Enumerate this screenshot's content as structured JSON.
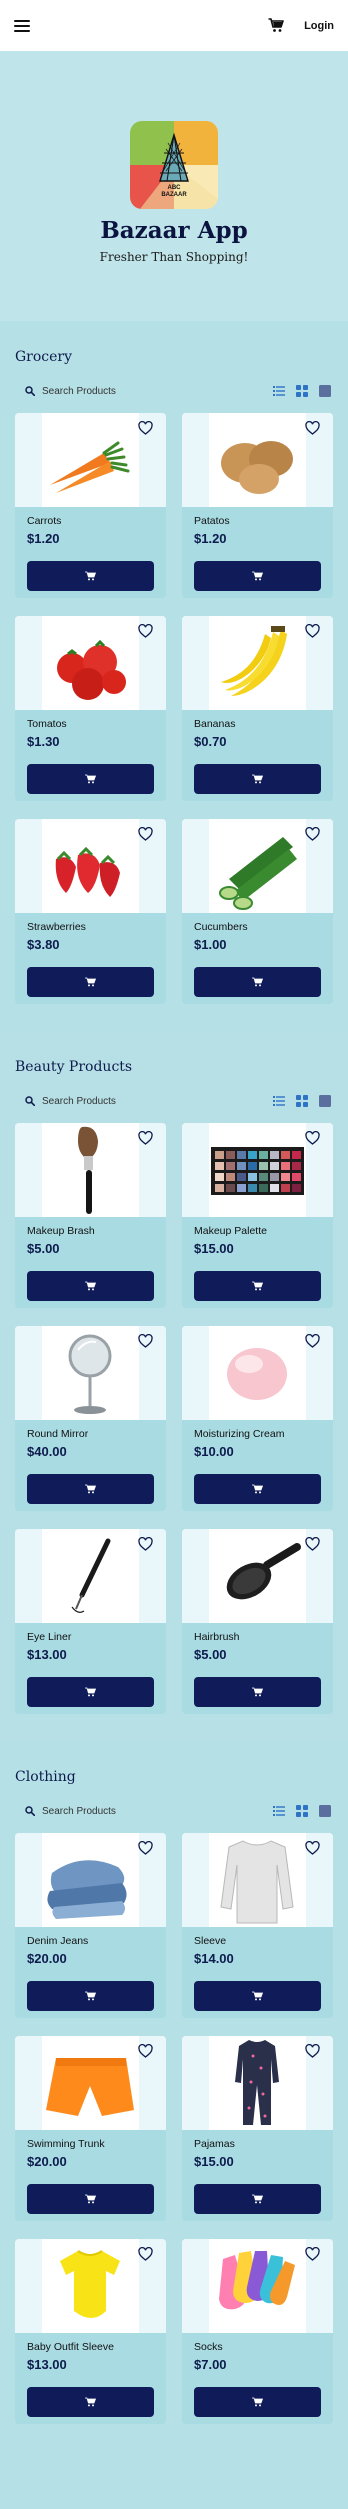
{
  "header": {
    "login_label": "Login",
    "menu_icon": "hamburger-menu-icon",
    "cart_icon": "shopping-cart-icon"
  },
  "hero": {
    "logo_text_line1": "ABC",
    "logo_text_line2": "BAZAAR",
    "title": "Bazaar App",
    "tagline": "Fresher Than Shopping!"
  },
  "colors": {
    "brand_navy": "#0f1c59",
    "page_bg": "#b5e0e6",
    "card_bg": "#a9dbe3",
    "toggle_active": "#2f73c7"
  },
  "sections": [
    {
      "title": "Grocery",
      "search_placeholder": "Search Products",
      "products": [
        {
          "name": "Carrots",
          "price": "$1.20"
        },
        {
          "name": "Patatos",
          "price": "$1.20"
        },
        {
          "name": "Tomatos",
          "price": "$1.30"
        },
        {
          "name": "Bananas",
          "price": "$0.70"
        },
        {
          "name": "Strawberries",
          "price": "$3.80"
        },
        {
          "name": "Cucumbers",
          "price": "$1.00"
        }
      ]
    },
    {
      "title": "Beauty Products",
      "search_placeholder": "Search Products",
      "products": [
        {
          "name": "Makeup Brash",
          "price": "$5.00"
        },
        {
          "name": "Makeup Palette",
          "price": "$15.00"
        },
        {
          "name": "Round Mirror",
          "price": "$40.00"
        },
        {
          "name": "Moisturizing Cream",
          "price": "$10.00"
        },
        {
          "name": "Eye Liner",
          "price": "$13.00"
        },
        {
          "name": "Hairbrush",
          "price": "$5.00"
        }
      ]
    },
    {
      "title": "Clothing",
      "search_placeholder": "Search Products",
      "products": [
        {
          "name": "Denim Jeans",
          "price": "$20.00"
        },
        {
          "name": "Sleeve",
          "price": "$14.00"
        },
        {
          "name": "Swimming Trunk",
          "price": "$20.00"
        },
        {
          "name": "Pajamas",
          "price": "$15.00"
        },
        {
          "name": "Baby Outfit Sleeve",
          "price": "$13.00"
        },
        {
          "name": "Socks",
          "price": "$7.00"
        }
      ]
    }
  ]
}
